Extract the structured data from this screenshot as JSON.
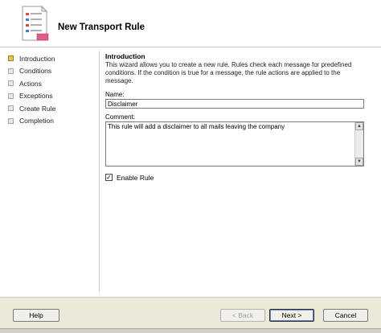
{
  "window": {
    "title": "New Transport Rule"
  },
  "nav": {
    "items": [
      {
        "label": "Introduction",
        "active": true
      },
      {
        "label": "Conditions",
        "active": false
      },
      {
        "label": "Actions",
        "active": false
      },
      {
        "label": "Exceptions",
        "active": false
      },
      {
        "label": "Create Rule",
        "active": false
      },
      {
        "label": "Completion",
        "active": false
      }
    ]
  },
  "intro": {
    "heading": "Introduction",
    "description": "This wizard allows you to create a new rule. Rules check each message for predefined conditions. If the condition is true for a message, the rule actions are applied to the message."
  },
  "form": {
    "name_label": "Name:",
    "name_value": "Disclaimer",
    "comment_label": "Comment:",
    "comment_value": "This rule will add a disclaimer to all mails leaving the company",
    "enable_label": "Enable Rule",
    "enable_checked": true
  },
  "buttons": {
    "help": "Help",
    "back": "< Back",
    "next": "Next >",
    "cancel": "Cancel"
  },
  "icons": {
    "wizard": "wizard-document-icon",
    "check": "checkmark-icon",
    "scroll_up": "scroll-up-arrow-icon",
    "scroll_down": "scroll-down-arrow-icon"
  },
  "colors": {
    "footer_bg": "#ece9d8",
    "active_step": "#e6c65a"
  }
}
